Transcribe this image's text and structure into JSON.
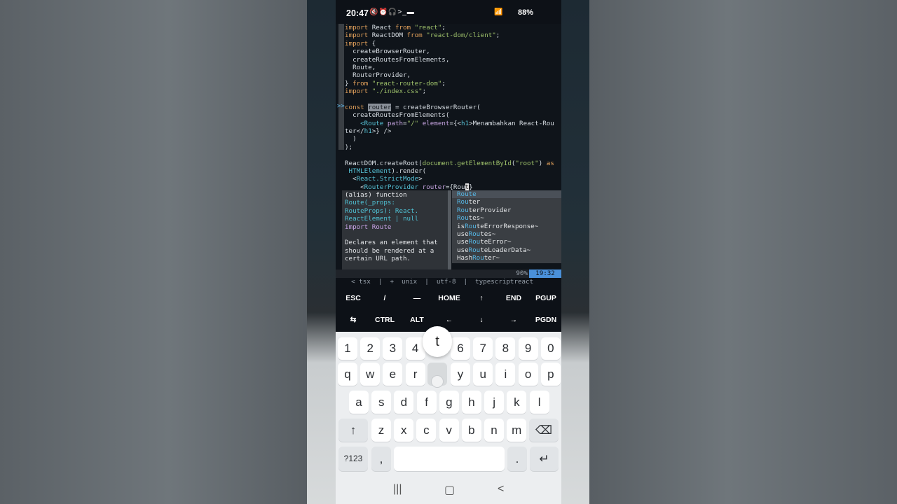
{
  "status_bar": {
    "time": "20:47",
    "left_icons": "🔇⏰🎧>_▬",
    "right_icons": "📶 ",
    "battery": "88%"
  },
  "editor": {
    "lines": [
      {
        "segs": [
          [
            "kw",
            "import"
          ],
          [
            "txt",
            " React "
          ],
          [
            "kw",
            "from"
          ],
          [
            "str",
            " \"react\""
          ],
          [
            "txt",
            ";"
          ]
        ]
      },
      {
        "segs": [
          [
            "kw",
            "import"
          ],
          [
            "txt",
            " ReactDOM "
          ],
          [
            "kw",
            "from"
          ],
          [
            "str",
            " \"react-dom/client\""
          ],
          [
            "txt",
            ";"
          ]
        ]
      },
      {
        "segs": [
          [
            "kw",
            "import"
          ],
          [
            "txt",
            " {"
          ]
        ]
      },
      {
        "segs": [
          [
            "txt",
            "  createBrowserRouter,"
          ]
        ]
      },
      {
        "segs": [
          [
            "txt",
            "  createRoutesFromElements,"
          ]
        ]
      },
      {
        "segs": [
          [
            "txt",
            "  Route,"
          ]
        ]
      },
      {
        "segs": [
          [
            "txt",
            "  RouterProvider,"
          ]
        ]
      },
      {
        "segs": [
          [
            "txt",
            "} "
          ],
          [
            "kw",
            "from"
          ],
          [
            "str",
            " \"react-router-dom\""
          ],
          [
            "txt",
            ";"
          ]
        ]
      },
      {
        "segs": [
          [
            "kw",
            "import"
          ],
          [
            "str",
            " \"./index.css\""
          ],
          [
            "txt",
            ";"
          ]
        ]
      },
      {
        "segs": [
          [
            "txt",
            ""
          ]
        ]
      },
      {
        "segs": [
          [
            "kw",
            "const"
          ],
          [
            "txt",
            " "
          ],
          [
            "sel",
            "router"
          ],
          [
            "txt",
            " = createBrowserRouter("
          ]
        ]
      },
      {
        "segs": [
          [
            "txt",
            "  createRoutesFromElements("
          ]
        ]
      },
      {
        "segs": [
          [
            "txt",
            "    "
          ],
          [
            "tag",
            "<Route"
          ],
          [
            "attr",
            " path"
          ],
          [
            "txt",
            "="
          ],
          [
            "str",
            "\"/\""
          ],
          [
            "attr",
            " element"
          ],
          [
            "txt",
            "={<"
          ],
          [
            "tag",
            "h1"
          ],
          [
            "txt",
            ">Menambahkan React-Rou"
          ]
        ]
      },
      {
        "segs": [
          [
            "txt",
            "ter</"
          ],
          [
            "tag",
            "h1"
          ],
          [
            "txt",
            ">} />"
          ]
        ]
      },
      {
        "segs": [
          [
            "txt",
            "  )"
          ]
        ]
      },
      {
        "segs": [
          [
            "txt",
            ");"
          ]
        ]
      },
      {
        "segs": [
          [
            "txt",
            ""
          ]
        ]
      },
      {
        "segs": [
          [
            "txt",
            "ReactDOM.createRoot("
          ],
          [
            "str",
            "document.getElementById"
          ],
          [
            "txt",
            "("
          ],
          [
            "str",
            "\"root\""
          ],
          [
            "txt",
            ") "
          ],
          [
            "kw",
            "as"
          ]
        ]
      },
      {
        "segs": [
          [
            "tag",
            " HTMLElement"
          ],
          [
            "txt",
            ").render("
          ]
        ]
      },
      {
        "segs": [
          [
            "txt",
            "  <"
          ],
          [
            "tag",
            "React.StrictMode"
          ],
          [
            "txt",
            ">"
          ]
        ]
      },
      {
        "segs": [
          [
            "txt",
            "    <"
          ],
          [
            "tag",
            "RouterProvider"
          ],
          [
            "attr",
            " router"
          ],
          [
            "txt",
            "={Rou"
          ],
          [
            "cursor",
            "t"
          ],
          [
            "txt",
            "}"
          ]
        ]
      }
    ],
    "marker": ">>"
  },
  "doc_popup": {
    "lines": [
      "(alias) function",
      "Route(_props:",
      "RouteProps): React.",
      "ReactElement | null",
      "import Route",
      "",
      "Declares an element that",
      "should be rendered at a",
      "certain URL path."
    ]
  },
  "completion_menu": {
    "items": [
      {
        "pre": "",
        "hl": "Route",
        "post": "",
        "selected": true
      },
      {
        "pre": "",
        "hl": "Rou",
        "post": "ter",
        "selected": false
      },
      {
        "pre": "",
        "hl": "Rou",
        "post": "terProvider",
        "selected": false
      },
      {
        "pre": "",
        "hl": "Rou",
        "post": "tes~",
        "selected": false
      },
      {
        "pre": "is",
        "hl": "Rou",
        "post": "teErrorResponse~",
        "selected": false
      },
      {
        "pre": "use",
        "hl": "Rou",
        "post": "tes~",
        "selected": false
      },
      {
        "pre": "use",
        "hl": "Rou",
        "post": "teError~",
        "selected": false
      },
      {
        "pre": "use",
        "hl": "Rou",
        "post": "teLoaderData~",
        "selected": false
      },
      {
        "pre": "Hash",
        "hl": "Rou",
        "post": "ter~",
        "selected": false
      }
    ]
  },
  "statusline": {
    "left": "< tsx  |  +  unix  |  utf-8  |  typescriptreact",
    "percent": "90%",
    "position": "19:32"
  },
  "extra_keys": {
    "row1": [
      "ESC",
      "/",
      "—",
      "HOME",
      "↑",
      "END",
      "PGUP"
    ],
    "row2": [
      "⇆",
      "CTRL",
      "ALT",
      "←",
      "↓",
      "→",
      "PGDN"
    ]
  },
  "keyboard": {
    "numbers": [
      "1",
      "2",
      "3",
      "4",
      "5",
      "6",
      "7",
      "8",
      "9",
      "0"
    ],
    "row1": [
      "q",
      "w",
      "e",
      "r",
      "t",
      "y",
      "u",
      "i",
      "o",
      "p"
    ],
    "row2": [
      "a",
      "s",
      "d",
      "f",
      "g",
      "h",
      "j",
      "k",
      "l"
    ],
    "row3": [
      "z",
      "x",
      "c",
      "v",
      "b",
      "n",
      "m"
    ],
    "popup_key": "t",
    "symbols_key": "?123",
    "comma_key": ",",
    "period_key": ".",
    "shift_icon": "↑",
    "backspace_icon": "⌫",
    "enter_icon": "↵"
  },
  "navbar": {
    "recents_icon": "|||",
    "home_icon": "▢",
    "back_icon": "<"
  }
}
